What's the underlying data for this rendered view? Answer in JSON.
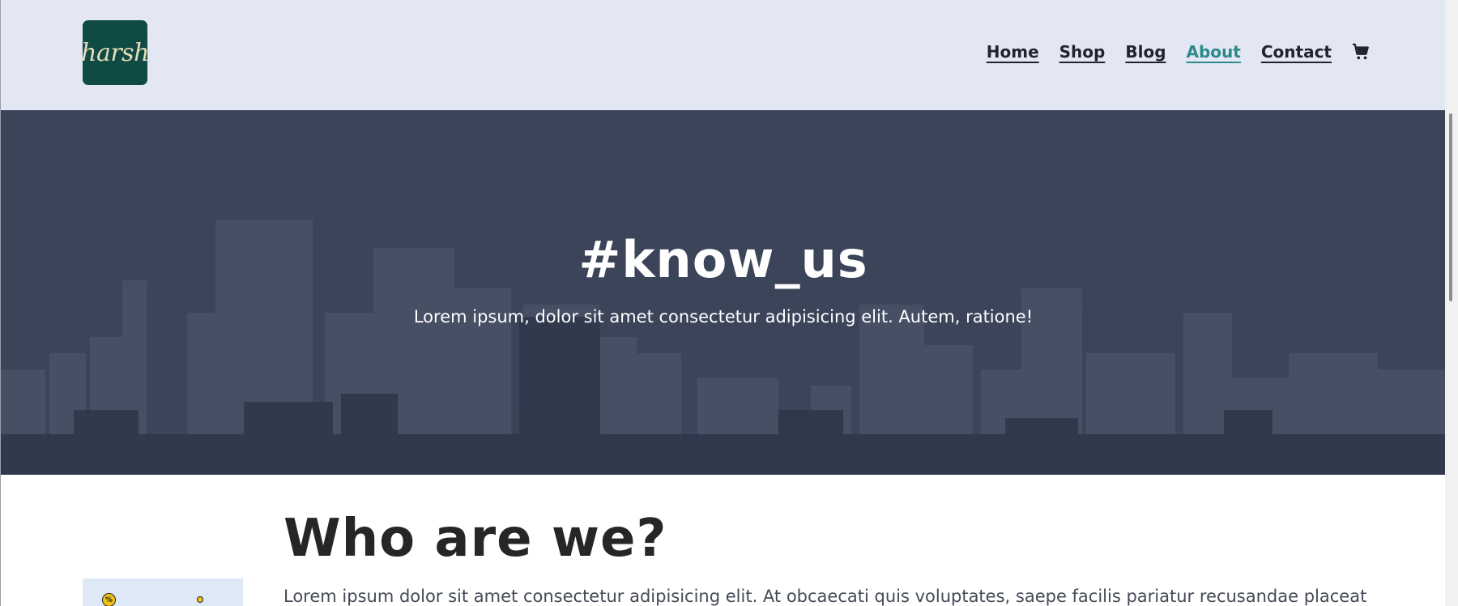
{
  "header": {
    "logo_text": "harsh",
    "nav": [
      {
        "label": "Home",
        "active": false
      },
      {
        "label": "Shop",
        "active": false
      },
      {
        "label": "Blog",
        "active": false
      },
      {
        "label": "About",
        "active": true
      },
      {
        "label": "Contact",
        "active": false
      }
    ],
    "cart_icon": "cart-icon"
  },
  "hero": {
    "title": "#know_us",
    "subtitle": "Lorem ipsum, dolor sit amet consectetur adipisicing elit. Autem, ratione!"
  },
  "about": {
    "title": "Who are we?",
    "text": "Lorem ipsum dolor sit amet consectetur adipisicing elit. At obcaecati quis voluptates, saepe facilis pariatur recusandae placeat",
    "illustration_badge": "%"
  },
  "colors": {
    "header_bg": "#e3e7f3",
    "logo_bg": "#0f4a44",
    "hero_overlay": "#3b4459",
    "active_link": "#2d8a8a",
    "heading_text": "#262626"
  }
}
